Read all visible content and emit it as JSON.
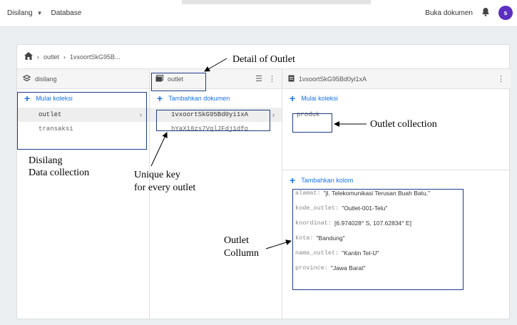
{
  "topbar": {
    "project": "Disilang",
    "section": "Database",
    "docs_link": "Buka dokumen",
    "avatar_letter": "s"
  },
  "path": {
    "segments": [
      "outlet",
      "1vxoortSkG95B..."
    ]
  },
  "columns": {
    "root": {
      "title": "disilang",
      "add_label": "Mulai koleksi",
      "items": [
        "outlet",
        "transaksi"
      ]
    },
    "collection": {
      "title": "outlet",
      "add_label": "Tambahkan dokumen",
      "items": [
        "1vxoortSkG95Bd0yi1xA",
        "hYaX18zs7VqlJFdj1dfo"
      ]
    },
    "document": {
      "title": "1vxoortSkG95Bd0yi1xA",
      "add_collection_label": "Mulai koleksi",
      "subcollections": [
        "produk"
      ],
      "add_field_label": "Tambahkan kolom",
      "fields": [
        {
          "key": "alamat:",
          "value": "\"jl. Telekomunikasi Terusan Buah Batu,\""
        },
        {
          "key": "kode_outlet:",
          "value": "\"Outlet-001-Telu\""
        },
        {
          "key": "koordinat:",
          "value": "[6.974028° S, 107.62834° E]"
        },
        {
          "key": "kota:",
          "value": "\"Bandung\""
        },
        {
          "key": "nama_outlet:",
          "value": "\"Kantin Tel-U\""
        },
        {
          "key": "province:",
          "value": "\"Jawa Barat\""
        }
      ]
    }
  },
  "annotations": {
    "detail": "Detail of Outlet",
    "outlet_collection": "Outlet collection",
    "disilang_1": "Disilang",
    "disilang_2": "Data collection",
    "unique_1": "Unique key",
    "unique_2": "for every outlet",
    "column_1": "Outlet",
    "column_2": "Collumn"
  },
  "colors": {
    "accent": "#1a73e8",
    "annotation_box": "#1f3c88",
    "avatar": "#5c2fc2"
  }
}
